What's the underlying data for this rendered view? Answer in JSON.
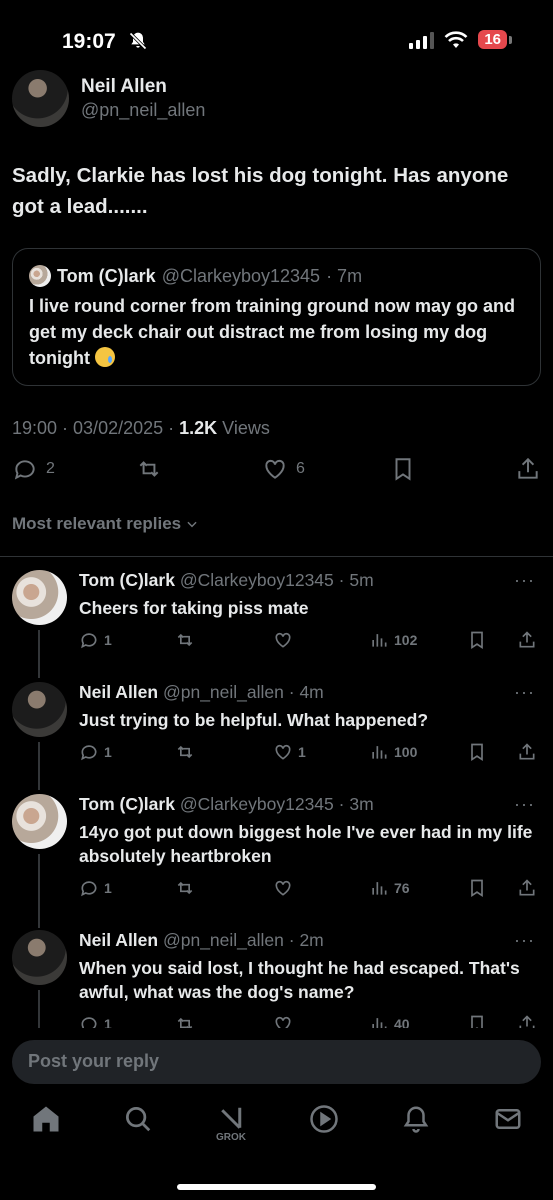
{
  "status_bar": {
    "time": "19:07",
    "battery": "16"
  },
  "tweet": {
    "author_name": "Neil Allen",
    "author_handle": "@pn_neil_allen",
    "text": "Sadly, Clarkie has lost his dog tonight. Has anyone got a lead.......",
    "quote": {
      "author_name": "Tom (C)lark",
      "author_handle": "@Clarkeyboy12345",
      "age": "· 7m",
      "text": "I live round corner from training ground now may go and get my deck chair out distract me from losing my dog tonight"
    },
    "timestamp": "19:00 · 03/02/2025 · ",
    "views_count": "1.2K",
    "views_label": " Views",
    "replies": "2",
    "likes": "6"
  },
  "replies_filter": "Most relevant replies",
  "replies": [
    {
      "name": "Tom (C)lark",
      "handle": "@Clarkeyboy12345",
      "age": " · 5m",
      "text": "Cheers for taking piss mate",
      "replies": "1",
      "likes": "",
      "views": "102"
    },
    {
      "name": "Neil Allen",
      "handle": "@pn_neil_allen",
      "age": " · 4m",
      "text": "Just trying to be helpful. What happened?",
      "replies": "1",
      "likes": "1",
      "views": "100"
    },
    {
      "name": "Tom (C)lark",
      "handle": "@Clarkeyboy12345",
      "age": " · 3m",
      "text": "14yo got put down biggest hole I've ever had in my life absolutely heartbroken",
      "replies": "1",
      "likes": "",
      "views": "76"
    },
    {
      "name": "Neil Allen",
      "handle": "@pn_neil_allen",
      "age": " · 2m",
      "text": "When you said lost, I thought he had escaped. That's awful, what was the dog's name?",
      "replies": "1",
      "likes": "",
      "views": "40"
    }
  ],
  "reply_bar": {
    "placeholder": "Post your reply"
  },
  "tabbar": {
    "grok_label": "GROK"
  },
  "colors": {
    "background": "#000000",
    "text": "#e7e9ea",
    "muted": "#71767b",
    "battery": "#e5484d"
  }
}
